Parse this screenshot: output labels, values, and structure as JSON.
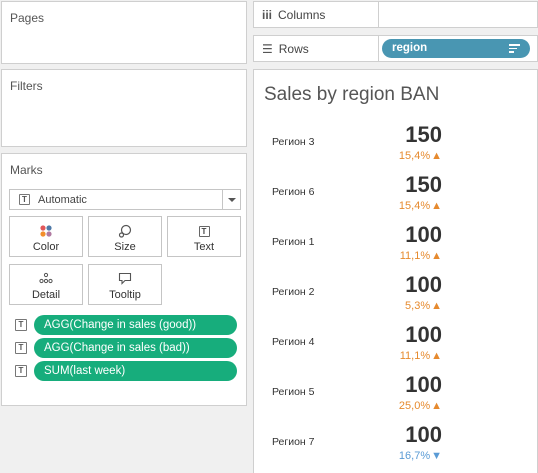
{
  "pages": {
    "title": "Pages"
  },
  "filters": {
    "title": "Filters"
  },
  "marks": {
    "title": "Marks",
    "type_selected": "Automatic",
    "buttons": [
      {
        "label": "Color",
        "icon": "color-dots-icon"
      },
      {
        "label": "Size",
        "icon": "size-icon"
      },
      {
        "label": "Text",
        "icon": "text-icon"
      },
      {
        "label": "Detail",
        "icon": "detail-dots-icon"
      },
      {
        "label": "Tooltip",
        "icon": "tooltip-icon"
      }
    ],
    "fields": [
      {
        "label": "AGG(Change in sales (good))"
      },
      {
        "label": "AGG(Change in sales (bad))"
      },
      {
        "label": "SUM(last week)"
      }
    ],
    "field_color": "#17ad7c"
  },
  "shelves": {
    "columns_label": "Columns",
    "rows_label": "Rows",
    "rows_pill": "region",
    "rows_pill_color": "#4996b2"
  },
  "viz": {
    "title": "Sales by region BAN",
    "rows": [
      {
        "region": "Регион 3",
        "value": "150",
        "change": "15,4%",
        "direction": "up"
      },
      {
        "region": "Регион 6",
        "value": "150",
        "change": "15,4%",
        "direction": "up"
      },
      {
        "region": "Регион 1",
        "value": "100",
        "change": "11,1%",
        "direction": "up"
      },
      {
        "region": "Регион 2",
        "value": "100",
        "change": "5,3%",
        "direction": "up"
      },
      {
        "region": "Регион 4",
        "value": "100",
        "change": "11,1%",
        "direction": "up"
      },
      {
        "region": "Регион 5",
        "value": "100",
        "change": "25,0%",
        "direction": "up"
      },
      {
        "region": "Регион 7",
        "value": "100",
        "change": "16,7%",
        "direction": "down"
      }
    ],
    "up_color": "#e68a2e",
    "down_color": "#5a9bd5"
  }
}
